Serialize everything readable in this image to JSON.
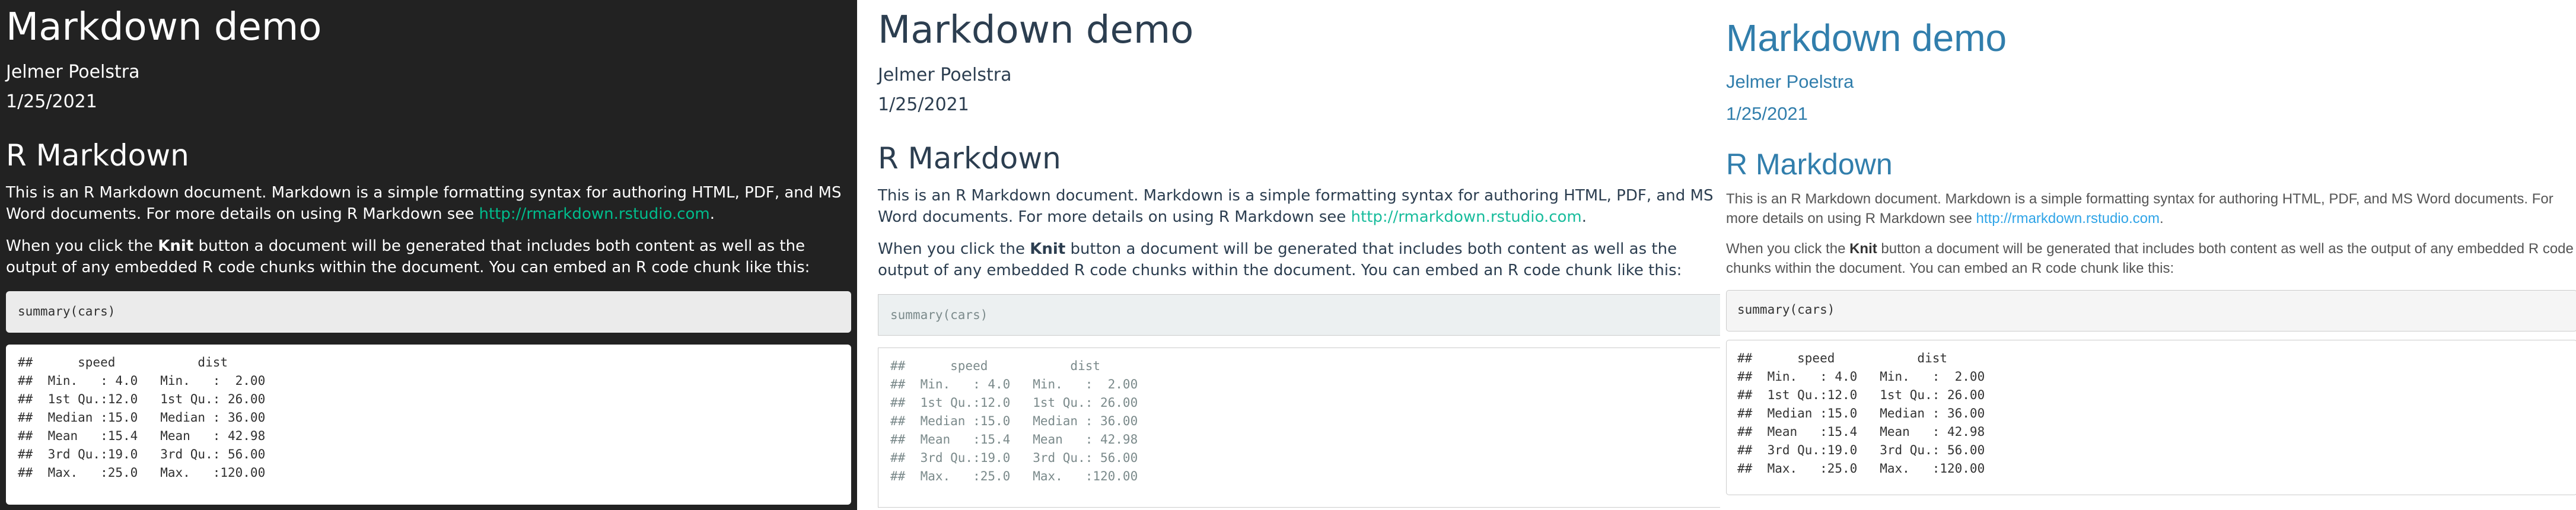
{
  "documents": [
    {
      "theme": "dark",
      "title": "Markdown demo",
      "author": "Jelmer Poelstra",
      "date": "1/25/2021",
      "section_heading": "R Markdown",
      "para1_text": "This is an R Markdown document. Markdown is a simple formatting syntax for authoring HTML, PDF, and MS Word documents. For more details on using R Markdown see ",
      "para1_link": "http://rmarkdown.rstudio.com",
      "para1_end": ".",
      "para2_before": "When you click the ",
      "para2_bold": "Knit",
      "para2_after": " button a document will be generated that includes both content as well as the output of any embedded R code chunks within the document. You can embed an R code chunk like this:",
      "code": "summary(cars)",
      "output": "##      speed           dist       \n##  Min.   : 4.0   Min.   :  2.00  \n##  1st Qu.:12.0   1st Qu.: 26.00  \n##  Median :15.0   Median : 36.00  \n##  Mean   :15.4   Mean   : 42.98  \n##  3rd Qu.:19.0   3rd Qu.: 56.00  \n##  Max.   :25.0   Max.   :120.00  ",
      "colors": {
        "background": "#222222",
        "link": "#00bc8c",
        "text": "#ffffff"
      }
    },
    {
      "theme": "flatly",
      "title": "Markdown demo",
      "author": "Jelmer Poelstra",
      "date": "1/25/2021",
      "section_heading": "R Markdown",
      "para1_text": "This is an R Markdown document. Markdown is a simple formatting syntax for authoring HTML, PDF, and MS Word documents. For more details on using R Markdown see ",
      "para1_link": "http://rmarkdown.rstudio.com",
      "para1_end": ".",
      "para2_before": "When you click the ",
      "para2_bold": "Knit",
      "para2_after": " button a document will be generated that includes both content as well as the output of any embedded R code chunks within the document. You can embed an R code chunk like this:",
      "code": "summary(cars)",
      "output": "##      speed           dist       \n##  Min.   : 4.0   Min.   :  2.00  \n##  1st Qu.:12.0   1st Qu.: 26.00  \n##  Median :15.0   Median : 36.00  \n##  Mean   :15.4   Mean   : 42.98  \n##  3rd Qu.:19.0   3rd Qu.: 56.00  \n##  Max.   :25.0   Max.   :120.00  ",
      "colors": {
        "background": "#ffffff",
        "link": "#18bc9c",
        "text": "#2c3e50"
      }
    },
    {
      "theme": "cerulean",
      "title": "Markdown demo",
      "author": "Jelmer Poelstra",
      "date": "1/25/2021",
      "section_heading": "R Markdown",
      "para1_text": "This is an R Markdown document. Markdown is a simple formatting syntax for authoring HTML, PDF, and MS Word documents. For more details on using R Markdown see ",
      "para1_link": "http://rmarkdown.rstudio.com",
      "para1_end": ".",
      "para2_before": "When you click the ",
      "para2_bold": "Knit",
      "para2_after": " button a document will be generated that includes both content as well as the output of any embedded R code chunks within the document. You can embed an R code chunk like this:",
      "code": "summary(cars)",
      "output": "##      speed           dist       \n##  Min.   : 4.0   Min.   :  2.00  \n##  1st Qu.:12.0   1st Qu.: 26.00  \n##  Median :15.0   Median : 36.00  \n##  Mean   :15.4   Mean   : 42.98  \n##  3rd Qu.:19.0   3rd Qu.: 56.00  \n##  Max.   :25.0   Max.   :120.00  ",
      "colors": {
        "background": "#ffffff",
        "link": "#2fa4e7",
        "heading": "#317eac",
        "text": "#555555"
      }
    }
  ]
}
